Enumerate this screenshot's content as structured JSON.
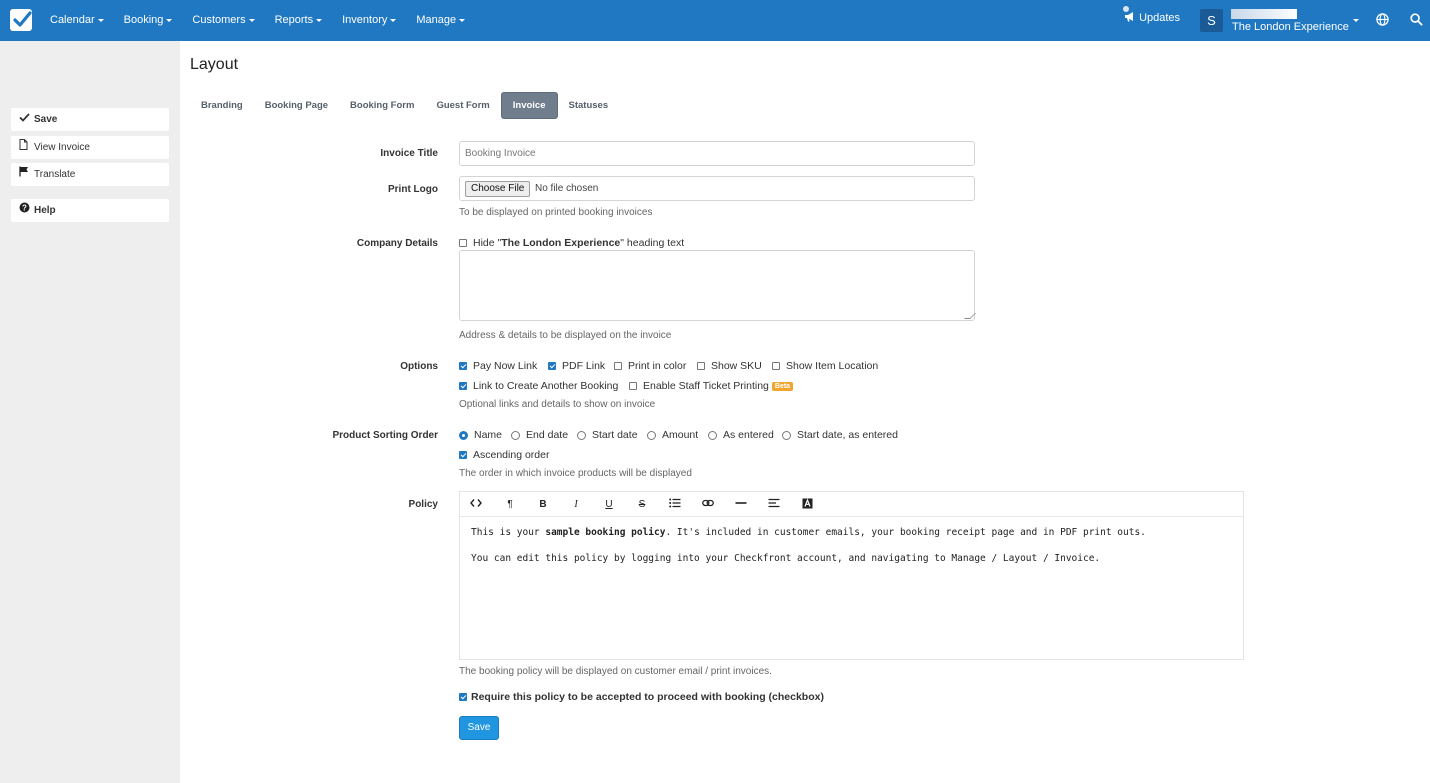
{
  "nav": {
    "items": [
      "Calendar",
      "Booking",
      "Customers",
      "Reports",
      "Inventory",
      "Manage"
    ],
    "updates": "Updates",
    "avatar_letter": "S",
    "account_name": "The London Experience"
  },
  "sidebar": {
    "save": "Save",
    "view_invoice": "View Invoice",
    "translate": "Translate",
    "help": "Help"
  },
  "page": {
    "title": "Layout",
    "tabs": [
      "Branding",
      "Booking Page",
      "Booking Form",
      "Guest Form",
      "Invoice",
      "Statuses"
    ],
    "active_tab": "Invoice"
  },
  "form": {
    "invoice_title_label": "Invoice Title",
    "invoice_title_value": "Booking Invoice",
    "print_logo_label": "Print Logo",
    "choose_file": "Choose File",
    "no_file": "No file chosen",
    "print_logo_help": "To be displayed on printed booking invoices",
    "company_details_label": "Company Details",
    "hide_heading_prefix": "Hide \"",
    "hide_heading_name": "The London Experience",
    "hide_heading_suffix": "\" heading text",
    "company_details_help": "Address & details to be displayed on the invoice",
    "options_label": "Options",
    "options": [
      {
        "label": "Pay Now Link",
        "checked": true
      },
      {
        "label": "PDF Link",
        "checked": true
      },
      {
        "label": "Print in color",
        "checked": false
      },
      {
        "label": "Show SKU",
        "checked": false
      },
      {
        "label": "Show Item Location",
        "checked": false
      },
      {
        "label": "Link to Create Another Booking",
        "checked": true
      },
      {
        "label": "Enable Staff Ticket Printing",
        "checked": false
      }
    ],
    "beta_badge": "Beta",
    "options_help": "Optional links and details to show on invoice",
    "sorting_label": "Product Sorting Order",
    "sorting": [
      {
        "label": "Name",
        "selected": true
      },
      {
        "label": "End date",
        "selected": false
      },
      {
        "label": "Start date",
        "selected": false
      },
      {
        "label": "Amount",
        "selected": false
      },
      {
        "label": "As entered",
        "selected": false
      },
      {
        "label": "Start date, as entered",
        "selected": false
      }
    ],
    "ascending_label": "Ascending order",
    "ascending_checked": true,
    "sorting_help": "The order in which invoice products will be displayed",
    "policy_label": "Policy",
    "toolbar_icons": [
      "code-icon",
      "paragraph-icon",
      "bold-icon",
      "italic-icon",
      "underline-icon",
      "strikethrough-icon",
      "list-icon",
      "link-icon",
      "horizontal-rule-icon",
      "align-icon",
      "font-color-icon"
    ],
    "policy_line1_prefix": "This is your ",
    "policy_line1_bold": "sample booking policy",
    "policy_line1_suffix": ". It's included in customer emails, your booking receipt page and in PDF print outs.",
    "policy_line2": "You can edit this policy by logging into your Checkfront account, and navigating to Manage / Layout / Invoice.",
    "policy_help": "The booking policy will be displayed on customer email / print invoices.",
    "require_policy": "Require this policy to be accepted to proceed with booking (checkbox)",
    "require_policy_checked": true,
    "save_button": "Save"
  },
  "colors": {
    "nav_bg": "#1f78c1",
    "accent": "#2196e0",
    "active_tab_bg": "#6f7d8c",
    "beta_bg": "#f0a630"
  }
}
